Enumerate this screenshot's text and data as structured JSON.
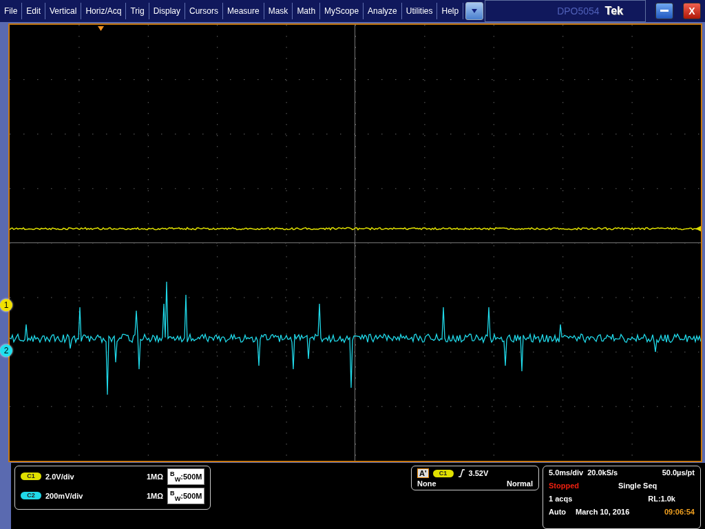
{
  "menu": [
    "File",
    "Edit",
    "Vertical",
    "Horiz/Acq",
    "Trig",
    "Display",
    "Cursors",
    "Measure",
    "Mask",
    "Math",
    "MyScope",
    "Analyze",
    "Utilities",
    "Help"
  ],
  "title_bar": {
    "model": "DPO5054",
    "brand": "Tek",
    "close_label": "X"
  },
  "markers": [
    {
      "label": "1",
      "color": "#f0e000"
    },
    {
      "label": "2",
      "color": "#20e0f0"
    }
  ],
  "channels": [
    {
      "badge": "C1",
      "color": "#e0e000",
      "scale": "2.0V/div",
      "impedance": "1MΩ",
      "bandwidth": "$^{B}$$_{W}$:500M"
    },
    {
      "badge": "C2",
      "color": "#20d8e8",
      "scale": "200mV/div",
      "impedance": "1MΩ",
      "bandwidth": "$^{B}$$_{W}$:500M"
    }
  ],
  "trigger": {
    "tag": "A'",
    "channel": "C1",
    "level": "3.52V",
    "coupling": "None",
    "mode": "Normal"
  },
  "acquisition": {
    "timebase": "5.0ms/div",
    "sample_rate": "20.0kS/s",
    "resolution": "50.0µs/pt",
    "state": "Stopped",
    "run_mode": "Single Seq",
    "acqs": "1 acqs",
    "record_length": "RL:1.0k",
    "trigger_mode": "Auto",
    "date": "March 10, 2016",
    "time": "09:06:54"
  }
}
